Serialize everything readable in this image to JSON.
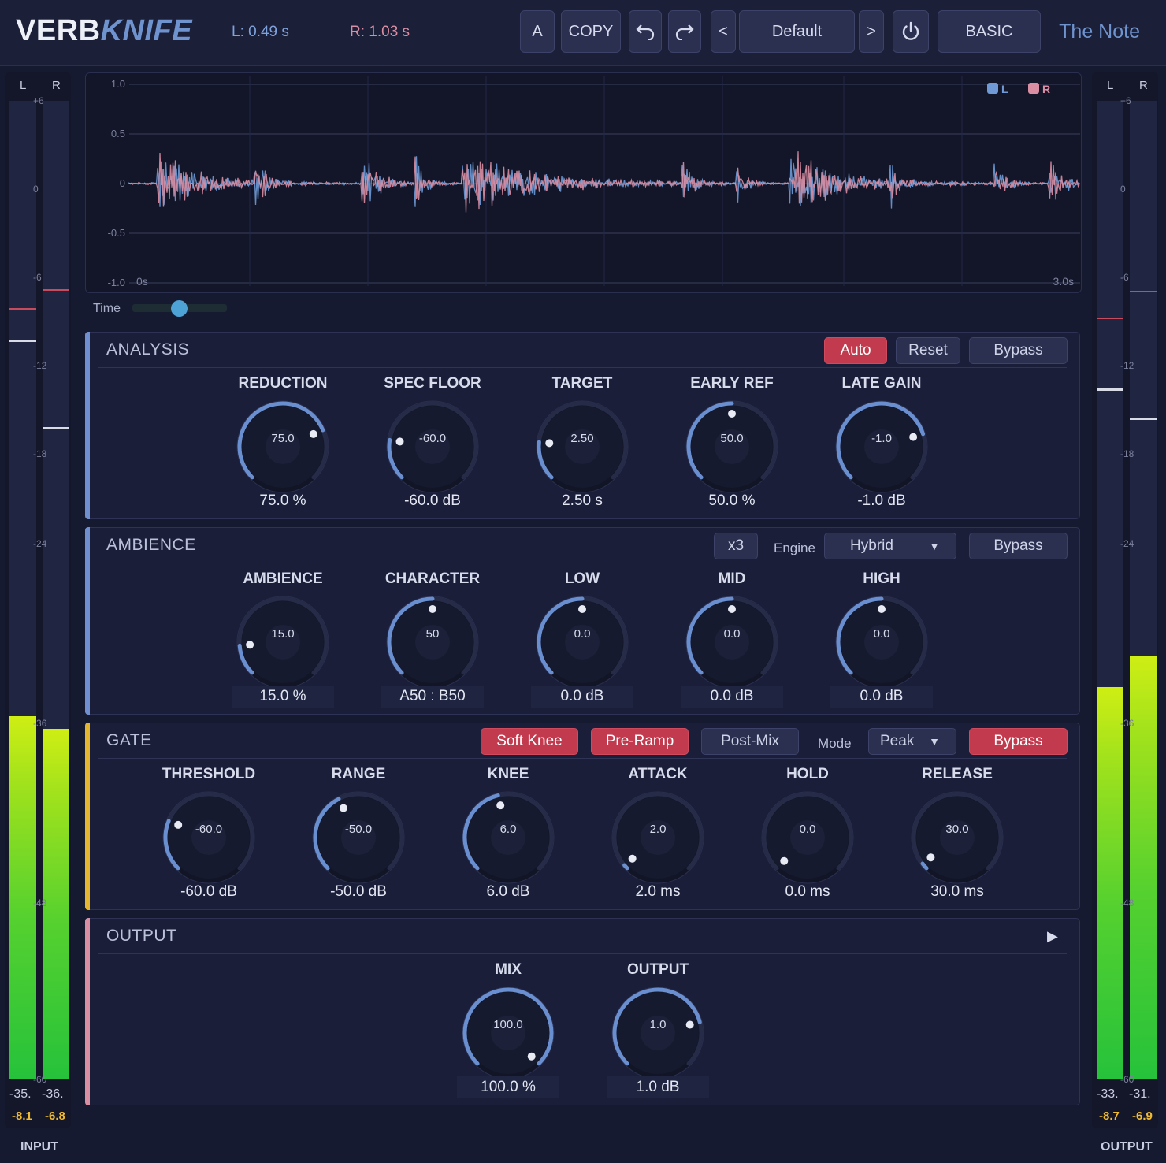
{
  "app": {
    "title_a": "VERB",
    "title_b": "KNIFE",
    "brand": "The Note"
  },
  "header": {
    "l_time": "L: 0.49 s",
    "r_time": "R: 1.03 s",
    "a_label": "A",
    "copy_label": "COPY",
    "prev_label": "<",
    "preset": "Default",
    "next_label": ">",
    "mode_label": "BASIC"
  },
  "meters": {
    "input": {
      "label": "INPUT",
      "l": "L",
      "r": "R",
      "l_val": "-35.",
      "r_val": "-36.",
      "l_peak": "-8.1",
      "r_peak": "-6.8",
      "l_level": 0.371,
      "r_level": 0.358
    },
    "output": {
      "label": "OUTPUT",
      "l": "L",
      "r": "R",
      "l_val": "-33.",
      "r_val": "-31.",
      "l_peak": "-8.7",
      "r_peak": "-6.9",
      "l_level": 0.401,
      "r_level": 0.433
    },
    "scale": [
      "+6",
      "0",
      "-6",
      "-12",
      "-18",
      "-24",
      "-36",
      "-48",
      "-60"
    ]
  },
  "waveform": {
    "y_ticks": [
      "1.0",
      "0.5",
      "0",
      "-0.5",
      "-1.0"
    ],
    "x_start": "0s",
    "x_end": "3.0s",
    "legend_l": "L",
    "legend_r": "R",
    "color_l": "#6f9ad6",
    "color_r": "#d98ea3",
    "time_label": "Time",
    "time_slider": 0.5
  },
  "analysis": {
    "title": "ANALYSIS",
    "auto": "Auto",
    "reset": "Reset",
    "bypass": "Bypass",
    "knobs": [
      {
        "title": "REDUCTION",
        "inner": "75.0",
        "value": "75.0 %",
        "pos": 0.75
      },
      {
        "title": "SPEC FLOOR",
        "inner": "-60.0",
        "value": "-60.0 dB",
        "pos": 0.2
      },
      {
        "title": "TARGET",
        "inner": "2.50",
        "value": "2.50 s",
        "pos": 0.19
      },
      {
        "title": "EARLY REF",
        "inner": "50.0",
        "value": "50.0 %",
        "pos": 0.5
      },
      {
        "title": "LATE GAIN",
        "inner": "-1.0",
        "value": "-1.0 dB",
        "pos": 0.77
      }
    ]
  },
  "ambience": {
    "title": "AMBIENCE",
    "mult": "x3",
    "engine_label": "Engine",
    "engine": "Hybrid",
    "bypass": "Bypass",
    "knobs": [
      {
        "title": "AMBIENCE",
        "inner": "15.0",
        "value": "15.0 %",
        "pos": 0.15
      },
      {
        "title": "CHARACTER",
        "inner": "50",
        "value": "A50 : B50",
        "pos": 0.5
      },
      {
        "title": "LOW",
        "inner": "0.0",
        "value": "0.0 dB",
        "pos": 0.5
      },
      {
        "title": "MID",
        "inner": "0.0",
        "value": "0.0 dB",
        "pos": 0.5
      },
      {
        "title": "HIGH",
        "inner": "0.0",
        "value": "0.0 dB",
        "pos": 0.5
      }
    ]
  },
  "gate": {
    "title": "GATE",
    "soft_knee": "Soft Knee",
    "pre_ramp": "Pre-Ramp",
    "post_mix": "Post-Mix",
    "mode_label": "Mode",
    "mode": "Peak",
    "bypass": "Bypass",
    "knobs": [
      {
        "title": "THRESHOLD",
        "inner": "-60.0",
        "value": "-60.0 dB",
        "pos": 0.25
      },
      {
        "title": "RANGE",
        "inner": "-50.0",
        "value": "-50.0 dB",
        "pos": 0.4
      },
      {
        "title": "KNEE",
        "inner": "6.0",
        "value": "6.0 dB",
        "pos": 0.45
      },
      {
        "title": "ATTACK",
        "inner": "2.0",
        "value": "2.0 ms",
        "pos": 0.02
      },
      {
        "title": "HOLD",
        "inner": "0.0",
        "value": "0.0 ms",
        "pos": 0.0
      },
      {
        "title": "RELEASE",
        "inner": "30.0",
        "value": "30.0 ms",
        "pos": 0.03
      }
    ]
  },
  "output_section": {
    "title": "OUTPUT",
    "knobs": [
      {
        "title": "MIX",
        "inner": "100.0",
        "value": "100.0 %",
        "pos": 1.0
      },
      {
        "title": "OUTPUT",
        "inner": "1.0",
        "value": "1.0 dB",
        "pos": 0.78
      }
    ]
  }
}
